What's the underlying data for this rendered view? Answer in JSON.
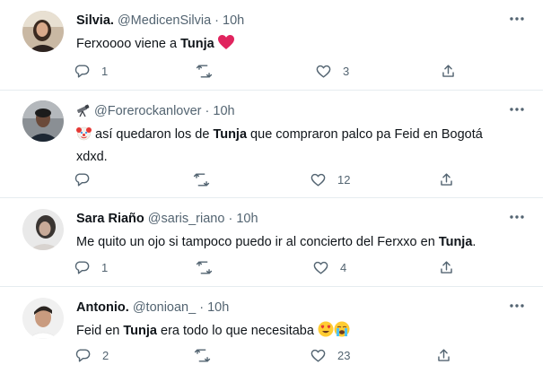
{
  "tweets": [
    {
      "name": "Silvia.",
      "handle": "@MedicenSilvia",
      "dot": "·",
      "time": "10h",
      "body_pre": "Ferxoooo viene a ",
      "body_hl": "Tunja",
      "body_post": "",
      "emoji": "red-heart",
      "counts": {
        "reply": "1",
        "retweet": "",
        "like": "3"
      }
    },
    {
      "name": "",
      "handle": "@Forerockanlover",
      "dot": "·",
      "time": "10h",
      "name_emoji": "telescope",
      "body_line1_pre": " así quedaron los  de ",
      "body_line1_hl": "Tunja",
      "body_line1_post": " que compraron palco pa Feid en Bogotá",
      "body_line2": "xdxd.",
      "emoji": "clown-face",
      "counts": {
        "reply": "",
        "retweet": "",
        "like": "12"
      }
    },
    {
      "name": "Sara Riaño",
      "handle": "@saris_riano",
      "dot": "·",
      "time": "10h",
      "body_pre": "Me quito un ojo si tampoco puedo ir al concierto del Ferxxo en ",
      "body_hl": "Tunja",
      "body_post": ".",
      "counts": {
        "reply": "1",
        "retweet": "",
        "like": "4"
      }
    },
    {
      "name": "Antonio.",
      "handle": "@tonioan_",
      "dot": "·",
      "time": "10h",
      "body_pre": "Feid en ",
      "body_hl": "Tunja",
      "body_post": " era todo lo que necesitaba ",
      "emojis": [
        "heart-eyes",
        "loudly-crying"
      ],
      "counts": {
        "reply": "2",
        "retweet": "",
        "like": "23"
      }
    }
  ],
  "colors": {
    "text": "#0f1419",
    "muted": "#536471",
    "divider": "#e6ecf0",
    "heart": "#e0245e"
  }
}
